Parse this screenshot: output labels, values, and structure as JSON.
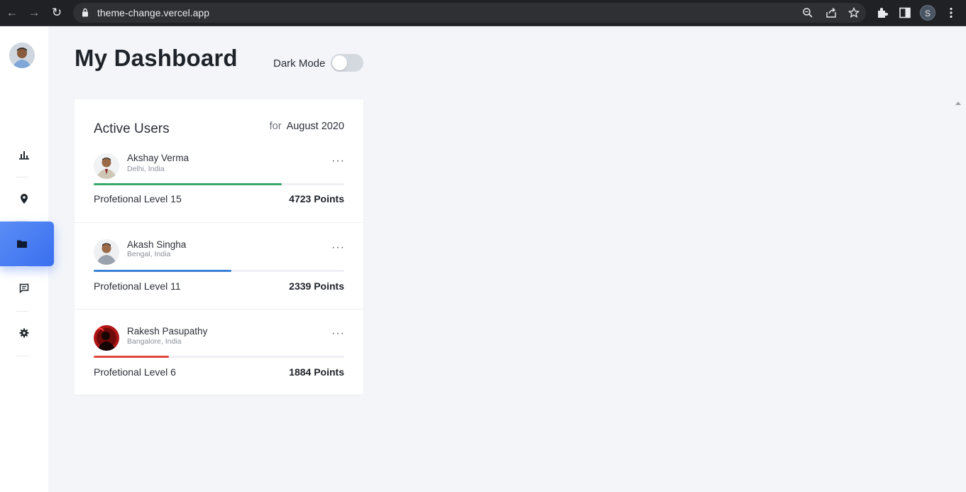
{
  "browser": {
    "url": "theme-change.vercel.app",
    "profile_initial": "S"
  },
  "sidebar": {
    "items": [
      {
        "name": "chart-icon"
      },
      {
        "name": "location-pin-icon"
      },
      {
        "name": "folder-icon",
        "active": true
      },
      {
        "name": "chat-icon"
      },
      {
        "name": "gear-icon"
      }
    ]
  },
  "header": {
    "title": "My Dashboard",
    "dark_mode_label": "Dark Mode",
    "dark_mode_on": false
  },
  "card": {
    "title": "Active Users",
    "for_label": "for",
    "period": "August 2020",
    "users": [
      {
        "name": "Akshay Verma",
        "location": "Delhi, India",
        "level": "Profetional Level 15",
        "points": "4723 Points",
        "progress": 0.75,
        "color": "#3aa76d"
      },
      {
        "name": "Akash Singha",
        "location": "Bengal, India",
        "level": "Profetional Level 11",
        "points": "2339 Points",
        "progress": 0.55,
        "color": "#3b82d6"
      },
      {
        "name": "Rakesh Pasupathy",
        "location": "Bangalore, India",
        "level": "Profetional Level 6",
        "points": "1884 Points",
        "progress": 0.3,
        "color": "#e0473f"
      }
    ],
    "more_label": "···"
  }
}
